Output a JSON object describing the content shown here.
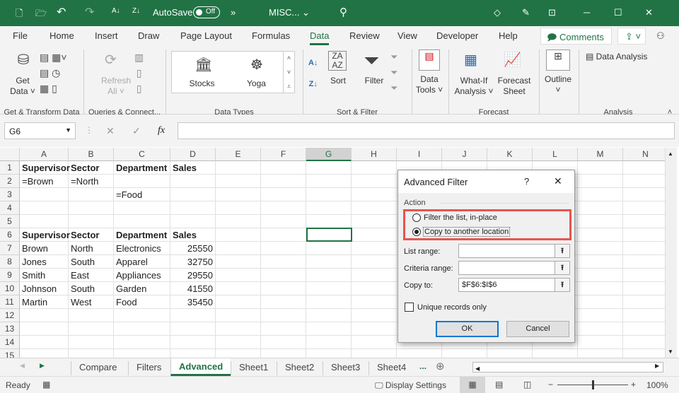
{
  "titlebar": {
    "autosave": "AutoSave",
    "toggle": "Off",
    "more": "»",
    "filename": "MISC... ⌄"
  },
  "tabs": [
    "File",
    "Home",
    "Insert",
    "Draw",
    "Page Layout",
    "Formulas",
    "Data",
    "Review",
    "View",
    "Developer",
    "Help"
  ],
  "active_tab": "Data",
  "comments": "Comments",
  "ribbon": {
    "get_data": "Get Data ˅",
    "refresh_all": "Refresh All ˅",
    "stocks": "Stocks",
    "yoga": "Yoga",
    "sort": "Sort",
    "filter": "Filter",
    "data_tools": "Data Tools ˅",
    "what_if": "What-If Analysis ˅",
    "forecast_sheet": "Forecast Sheet",
    "outline": "Outline",
    "data_analysis": "Data Analysis",
    "groups": [
      "Get & Transform Data",
      "Queries & Connect...",
      "Data Types",
      "Sort & Filter",
      "Forecast",
      "Analysis"
    ]
  },
  "formula_bar": {
    "name_box": "G6",
    "fx": "fx",
    "formula": ""
  },
  "columns": [
    "A",
    "B",
    "C",
    "D",
    "E",
    "F",
    "G",
    "H",
    "I",
    "J",
    "K",
    "L",
    "M",
    "N"
  ],
  "selected_column": "G",
  "rows": [
    {
      "n": "1",
      "A": "Supervisor",
      "B": "Sector",
      "C": "Department",
      "D": "Sales",
      "bold": true
    },
    {
      "n": "2",
      "A": "=Brown",
      "B": "=North",
      "C": "",
      "D": ""
    },
    {
      "n": "3",
      "A": "",
      "B": "",
      "C": "=Food",
      "D": ""
    },
    {
      "n": "4",
      "A": "",
      "B": "",
      "C": "",
      "D": ""
    },
    {
      "n": "5",
      "A": "",
      "B": "",
      "C": "",
      "D": ""
    },
    {
      "n": "6",
      "A": "Supervisor",
      "B": "Sector",
      "C": "Department",
      "D": "Sales",
      "bold": true
    },
    {
      "n": "7",
      "A": "Brown",
      "B": "North",
      "C": "Electronics",
      "D": "25550"
    },
    {
      "n": "8",
      "A": "Jones",
      "B": "South",
      "C": "Apparel",
      "D": "32750"
    },
    {
      "n": "9",
      "A": "Smith",
      "B": "East",
      "C": "Appliances",
      "D": "29550"
    },
    {
      "n": "10",
      "A": "Johnson",
      "B": "South",
      "C": "Garden",
      "D": "41550"
    },
    {
      "n": "11",
      "A": "Martin",
      "B": "West",
      "C": "Food",
      "D": "35450"
    },
    {
      "n": "12",
      "A": "",
      "B": "",
      "C": "",
      "D": ""
    },
    {
      "n": "13",
      "A": "",
      "B": "",
      "C": "",
      "D": ""
    },
    {
      "n": "14",
      "A": "",
      "B": "",
      "C": "",
      "D": ""
    },
    {
      "n": "15",
      "A": "",
      "B": "",
      "C": "",
      "D": ""
    }
  ],
  "sheets": [
    "Compare",
    "Filters",
    "Advanced",
    "Sheet1",
    "Sheet2",
    "Sheet3",
    "Sheet4"
  ],
  "active_sheet": "Advanced",
  "sheets_more": "...",
  "status": {
    "ready": "Ready",
    "display_settings": "Display Settings",
    "zoom": "100%",
    "zoom_level": 100
  },
  "dialog": {
    "title": "Advanced Filter",
    "help": "?",
    "close": "✕",
    "action": "Action",
    "opt1": "Filter the list, in-place",
    "opt2": "Copy to another location",
    "selected_option": 2,
    "list_range_label": "List range:",
    "list_range": "",
    "criteria_label": "Criteria range:",
    "criteria": "",
    "copy_to_label": "Copy to:",
    "copy_to": "$F$6:$I$6",
    "unique": "Unique records only",
    "unique_checked": false,
    "ok": "OK",
    "cancel": "Cancel"
  },
  "colors": {
    "brand": "#217346",
    "highlight": "#e8554e"
  }
}
